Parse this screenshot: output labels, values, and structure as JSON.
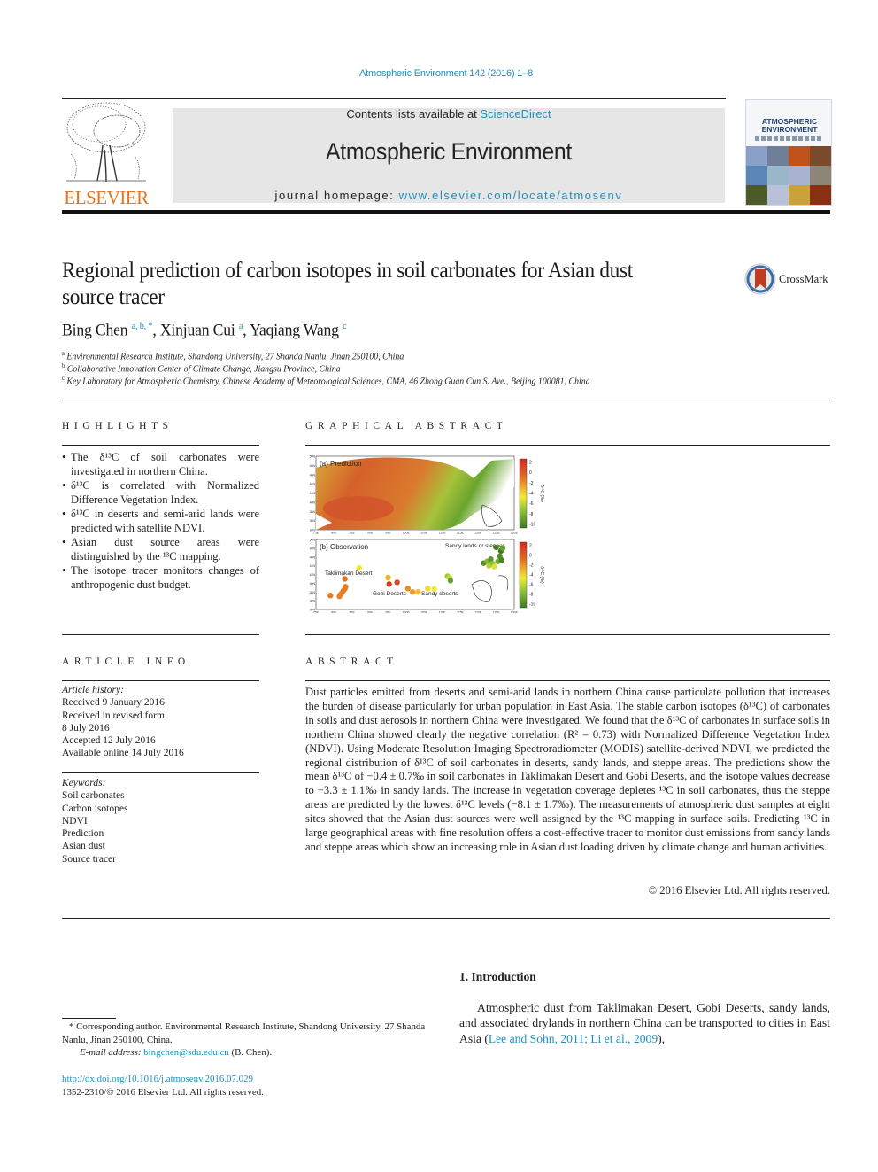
{
  "header": {
    "citation": "Atmospheric Environment 142 (2016) 1–8",
    "contents_prefix": "Contents lists available at ",
    "contents_link": "ScienceDirect",
    "journal_name": "Atmospheric Environment",
    "homepage_prefix": "journal homepage: ",
    "homepage_link": "www.elsevier.com/locate/atmosenv",
    "publisher_logo_text": "ELSEVIER",
    "cover_title_line1": "ATMOSPHERIC",
    "cover_title_line2": "ENVIRONMENT"
  },
  "article": {
    "title": "Regional prediction of carbon isotopes in soil carbonates for Asian dust source tracer",
    "crossmark_label": "CrossMark",
    "authors": [
      {
        "name": "Bing Chen",
        "marks": "a, b, *"
      },
      {
        "name": "Xinjuan Cui",
        "marks": "a"
      },
      {
        "name": "Yaqiang Wang",
        "marks": "c"
      }
    ],
    "affiliations": [
      {
        "mark": "a",
        "text": "Environmental Research Institute, Shandong University, 27 Shanda Nanlu, Jinan 250100, China"
      },
      {
        "mark": "b",
        "text": "Collaborative Innovation Center of Climate Change, Jiangsu Province, China"
      },
      {
        "mark": "c",
        "text": "Key Laboratory for Atmospheric Chemistry, Chinese Academy of Meteorological Sciences, CMA, 46 Zhong Guan Cun S. Ave., Beijing 100081, China"
      }
    ]
  },
  "highlights": {
    "heading": "HIGHLIGHTS",
    "items": [
      "The δ¹³C of soil carbonates were investigated in northern China.",
      "δ¹³C is correlated with Normalized Difference Vegetation Index.",
      "δ¹³C in deserts and semi-arid lands were predicted with satellite NDVI.",
      "Asian dust source areas were distinguished by the ¹³C mapping.",
      "The isotope tracer monitors changes of anthropogenic dust budget."
    ]
  },
  "graphical_abstract": {
    "heading": "GRAPHICAL ABSTRACT",
    "panel_a_label": "(a) Prediction",
    "panel_b_label": "(b) Observation",
    "colorbar_label": "δ¹³C (‰)",
    "colorbar_ticks": [
      "2",
      "0",
      "-2",
      "-4",
      "-6",
      "-8",
      "-10"
    ],
    "lat_ticks": [
      "50N",
      "48N",
      "46N",
      "44N",
      "42N",
      "40N",
      "38N",
      "36N",
      "34N"
    ],
    "lon_ticks": [
      "75E",
      "80E",
      "85E",
      "90E",
      "95E",
      "100E",
      "105E",
      "110E",
      "115E",
      "120E",
      "125E",
      "130E"
    ],
    "region_labels": [
      "Taklimakan Desert",
      "Gobi Deserts",
      "Sandy deserts",
      "Sandy lands or steppes"
    ],
    "observation_sites": [
      {
        "lon": 79,
        "lat": 37.2,
        "d13c": -0.5
      },
      {
        "lon": 81.5,
        "lat": 37.0,
        "d13c": -0.8
      },
      {
        "lon": 81.8,
        "lat": 37.4,
        "d13c": -0.6
      },
      {
        "lon": 82.2,
        "lat": 37.8,
        "d13c": -0.7
      },
      {
        "lon": 82.6,
        "lat": 38.3,
        "d13c": -0.5
      },
      {
        "lon": 83.0,
        "lat": 38.7,
        "d13c": -0.6
      },
      {
        "lon": 83.2,
        "lat": 39.2,
        "d13c": -0.4
      },
      {
        "lon": 83.0,
        "lat": 41.0,
        "d13c": -0.3
      },
      {
        "lon": 87.0,
        "lat": 43.5,
        "d13c": -4.0
      },
      {
        "lon": 95.0,
        "lat": 41.3,
        "d13c": -2.0
      },
      {
        "lon": 95.3,
        "lat": 39.8,
        "d13c": 1.5
      },
      {
        "lon": 97.5,
        "lat": 40.2,
        "d13c": 1.0
      },
      {
        "lon": 100.5,
        "lat": 38.8,
        "d13c": -1.0
      },
      {
        "lon": 101.8,
        "lat": 38.0,
        "d13c": -1.5
      },
      {
        "lon": 103.3,
        "lat": 38.0,
        "d13c": -2.5
      },
      {
        "lon": 106.0,
        "lat": 38.8,
        "d13c": -3.5
      },
      {
        "lon": 107.8,
        "lat": 38.7,
        "d13c": -4.0
      },
      {
        "lon": 111.5,
        "lat": 41.6,
        "d13c": -6.0
      },
      {
        "lon": 112.0,
        "lat": 41.3,
        "d13c": -5.0
      },
      {
        "lon": 112.3,
        "lat": 40.6,
        "d13c": -8.0
      },
      {
        "lon": 121.5,
        "lat": 44.6,
        "d13c": -9.0
      },
      {
        "lon": 122.5,
        "lat": 45.0,
        "d13c": -7.0
      },
      {
        "lon": 123.0,
        "lat": 44.0,
        "d13c": -5.5
      },
      {
        "lon": 123.5,
        "lat": 45.5,
        "d13c": -8.5
      },
      {
        "lon": 124.0,
        "lat": 44.5,
        "d13c": -6.5
      },
      {
        "lon": 124.5,
        "lat": 43.8,
        "d13c": -4.5
      },
      {
        "lon": 125.0,
        "lat": 48.2,
        "d13c": -9.5
      },
      {
        "lon": 125.5,
        "lat": 45.0,
        "d13c": -7.5
      },
      {
        "lon": 126.0,
        "lat": 46.2,
        "d13c": -9.0
      },
      {
        "lon": 126.3,
        "lat": 47.4,
        "d13c": -10.0
      },
      {
        "lon": 126.8,
        "lat": 48.0,
        "d13c": -8.0
      },
      {
        "lon": 126.5,
        "lat": 45.3,
        "d13c": -9.5
      }
    ]
  },
  "article_info": {
    "heading": "ARTICLE INFO",
    "history_label": "Article history:",
    "history": [
      "Received 9 January 2016",
      "Received in revised form",
      "8 July 2016",
      "Accepted 12 July 2016",
      "Available online 14 July 2016"
    ],
    "keywords_label": "Keywords:",
    "keywords": [
      "Soil carbonates",
      "Carbon isotopes",
      "NDVI",
      "Prediction",
      "Asian dust",
      "Source tracer"
    ]
  },
  "abstract": {
    "heading": "ABSTRACT",
    "text": "Dust particles emitted from deserts and semi-arid lands in northern China cause particulate pollution that increases the burden of disease particularly for urban population in East Asia. The stable carbon isotopes (δ¹³C) of carbonates in soils and dust aerosols in northern China were investigated. We found that the δ¹³C of carbonates in surface soils in northern China showed clearly the negative correlation (R² = 0.73) with Normalized Difference Vegetation Index (NDVI). Using Moderate Resolution Imaging Spectroradiometer (MODIS) satellite-derived NDVI, we predicted the regional distribution of δ¹³C of soil carbonates in deserts, sandy lands, and steppe areas. The predictions show the mean δ¹³C of −0.4 ± 0.7‰ in soil carbonates in Taklimakan Desert and Gobi Deserts, and the isotope values decrease to −3.3 ± 1.1‰ in sandy lands. The increase in vegetation coverage depletes ¹³C in soil carbonates, thus the steppe areas are predicted by the lowest δ¹³C levels (−8.1 ± 1.7‰). The measurements of atmospheric dust samples at eight sites showed that the Asian dust sources were well assigned by the ¹³C mapping in surface soils. Predicting ¹³C in large geographical areas with fine resolution offers a cost-effective tracer to monitor dust emissions from sandy lands and steppe areas which show an increasing role in Asian dust loading driven by climate change and human activities.",
    "copyright": "© 2016 Elsevier Ltd. All rights reserved."
  },
  "introduction": {
    "heading": "1.  Introduction",
    "text_before_refs": "Atmospheric dust from Taklimakan Desert, Gobi Deserts, sandy lands, and associated drylands in northern China can be transported to cities in East Asia (",
    "refs": "Lee and Sohn, 2011; Li et al., 2009",
    "text_after_refs": "),"
  },
  "footnotes": {
    "corresponding": "* Corresponding author. Environmental Research Institute, Shandong University, 27 Shanda Nanlu, Jinan 250100, China.",
    "email_label": "E-mail address: ",
    "email": "bingchen@sdu.edu.cn",
    "email_suffix": " (B. Chen).",
    "doi": "http://dx.doi.org/10.1016/j.atmosenv.2016.07.029",
    "issn": "1352-2310/© 2016 Elsevier Ltd. All rights reserved."
  },
  "colors": {
    "link": "#1f8fbf",
    "elsevier_orange": "#e8731c",
    "banner_gray": "#e6e6e6"
  }
}
